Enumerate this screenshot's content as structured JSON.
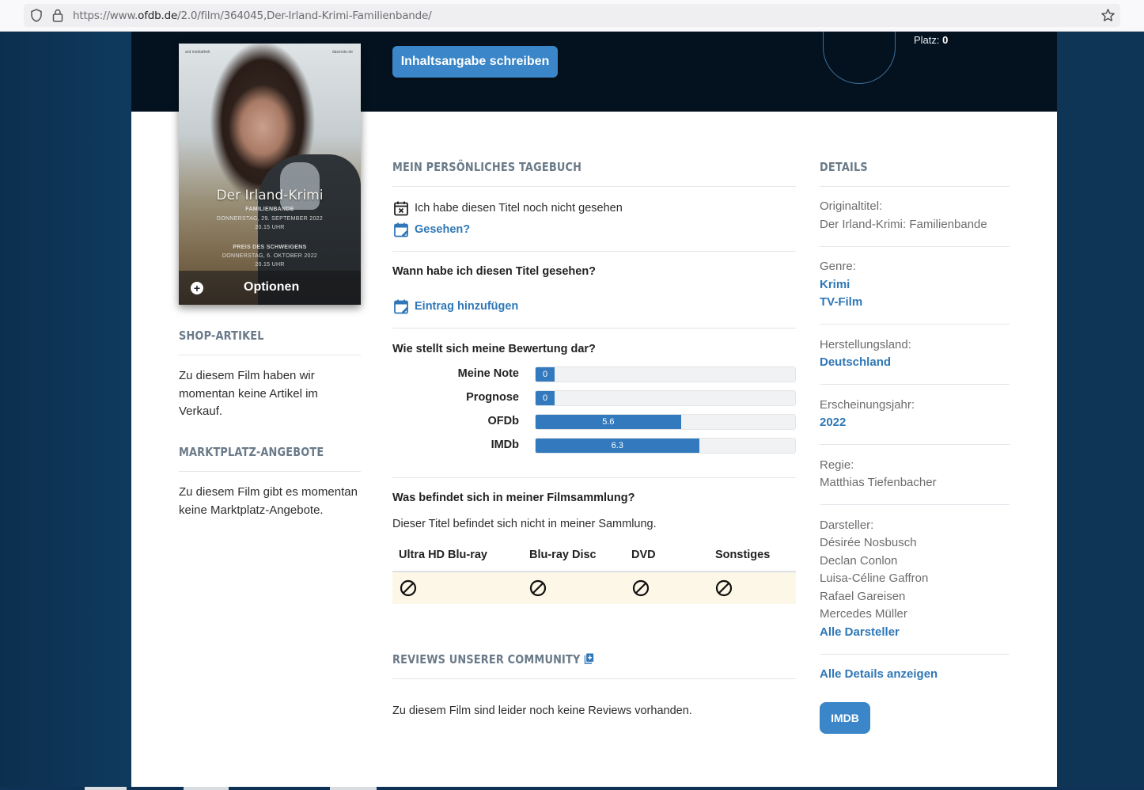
{
  "browser": {
    "url_prefix": "https://www.",
    "url_host": "ofdb.de",
    "url_path": "/2.0/film/364045,Der-Irland-Krimi-Familienbande/"
  },
  "header": {
    "platz_label": "Platz:",
    "platz_value": "0",
    "write_summary_button": "Inhaltsangabe schreiben"
  },
  "poster": {
    "top_left": "ard mediathek",
    "top_right": "daserste.de",
    "title": "Der Irland-Krimi",
    "line1": "FAMILIENBANDE",
    "line2": "DONNERSTAG, 29. SEPTEMBER 2022",
    "line3": "20.15 UHR",
    "line4": "PREIS DES SCHWEIGENS",
    "line5": "DONNERSTAG, 6. OKTOBER 2022",
    "line6": "20.15 UHR",
    "options_label": "Optionen"
  },
  "left": {
    "shop_heading": "SHOP-ARTIKEL",
    "shop_text": "Zu diesem Film haben wir momentan keine Artikel im Verkauf.",
    "market_heading": "MARKTPLATZ-ANGEBOTE",
    "market_text": "Zu diesem Film gibt es momentan keine Marktplatz-Angebote."
  },
  "diary": {
    "heading": "MEIN PERSÖNLICHES TAGEBUCH",
    "not_seen_text": "Ich habe diesen Titel noch nicht gesehen",
    "seen_link": "Gesehen?",
    "when_question": "Wann habe ich diesen Titel gesehen?",
    "add_entry_link": "Eintrag hinzufügen",
    "rating_question": "Wie stellt sich meine Bewertung dar?",
    "ratings": [
      {
        "label": "Meine Note",
        "value": "0",
        "fraction": 0
      },
      {
        "label": "Prognose",
        "value": "0",
        "fraction": 0
      },
      {
        "label": "OFDb",
        "value": "5.6",
        "fraction": 0.56
      },
      {
        "label": "IMDb",
        "value": "6.3",
        "fraction": 0.63
      }
    ],
    "collection_question": "Was befindet sich in meiner Filmsammlung?",
    "collection_text": "Dieser Titel befindet sich nicht in meiner Sammlung.",
    "collection_columns": [
      "Ultra HD Blu-ray",
      "Blu-ray Disc",
      "DVD",
      "Sonstiges"
    ],
    "collection_icon": "not-available-icon"
  },
  "reviews": {
    "heading": "REVIEWS UNSERER COMMUNITY",
    "empty_text": "Zu diesem Film sind leider noch keine Reviews vorhanden."
  },
  "details": {
    "heading": "DETAILS",
    "original_title_label": "Originaltitel:",
    "original_title": "Der Irland-Krimi: Familienbande",
    "genre_label": "Genre:",
    "genres": [
      "Krimi",
      "TV-Film"
    ],
    "country_label": "Herstellungsland:",
    "country": "Deutschland",
    "year_label": "Erscheinungsjahr:",
    "year": "2022",
    "director_label": "Regie:",
    "director": "Matthias Tiefenbacher",
    "cast_label": "Darsteller:",
    "cast": [
      "Désirée Nosbusch",
      "Declan Conlon",
      "Luisa-Céline Gaffron",
      "Rafael Gareisen",
      "Mercedes Müller"
    ],
    "all_cast_link": "Alle Darsteller",
    "all_details_link": "Alle Details anzeigen",
    "imdb_button": "IMDB"
  },
  "colors": {
    "accent": "#3a86c8",
    "link": "#2f77b7",
    "header_dark": "#04121f",
    "page_bg": "#0e3556"
  }
}
